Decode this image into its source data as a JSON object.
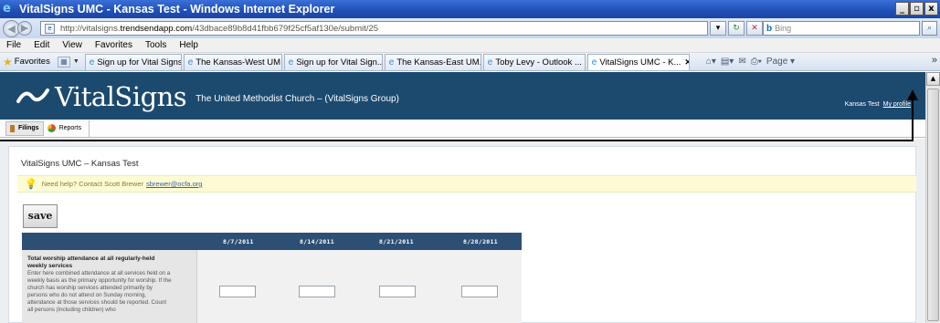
{
  "window": {
    "title": "VitalSigns UMC - Kansas Test - Windows Internet Explorer",
    "controls": [
      "_",
      "▫",
      "x"
    ]
  },
  "address_bar": {
    "url_prefix": "http://vitalsigns.",
    "url_host": "trendsendapp.com",
    "url_path": "/43dbace89b8d41fbb679f25cf5af130e/submit/25",
    "search_placeholder": "Bing"
  },
  "menu": [
    "File",
    "Edit",
    "View",
    "Favorites",
    "Tools",
    "Help"
  ],
  "favorites_bar": {
    "label": "Favorites",
    "tabs": [
      {
        "label": "Sign up for Vital Signs",
        "active": false
      },
      {
        "label": "The Kansas-West UM...",
        "active": false
      },
      {
        "label": "Sign up for Vital Sign...",
        "active": false
      },
      {
        "label": "The Kansas-East UM...",
        "active": false
      },
      {
        "label": "Toby Levy - Outlook ...",
        "active": false
      },
      {
        "label": "VitalSigns UMC - K...",
        "active": true
      }
    ],
    "page_menu": "Page"
  },
  "app": {
    "brand_name": "VitalSigns",
    "brand_subtitle": "The United Methodist Church – (VitalSigns Group)",
    "user_name": "Kansas Test",
    "profile_link": "My profile",
    "tabs": [
      {
        "label": "Filings",
        "active": true
      },
      {
        "label": "Reports",
        "active": false
      }
    ]
  },
  "page": {
    "org_title": "VitalSigns UMC – Kansas Test",
    "help_text": "Need help? Contact Scott Brewer",
    "help_email": "sbrewer@ocfa.org",
    "save_label": "save"
  },
  "grid": {
    "dates": [
      "8/7/2011",
      "8/14/2011",
      "8/21/2011",
      "8/28/2011"
    ],
    "field_title": "Total worship attendance at all regularly-held weekly services",
    "field_description": "Enter here combined attendance at all services held on a weekly basis as the primary opportunity for worship. If the church has worship services attended primarily by persons who do not attend on Sunday morning, attendance at those services should be reported. Count all persons (including children) who",
    "values": [
      "",
      "",
      "",
      ""
    ]
  },
  "colors": {
    "app_header": "#1c4a6f",
    "grid_header": "#2d4f74",
    "help_bar": "#fdfbd3",
    "window_title": "#1f4fb5"
  }
}
